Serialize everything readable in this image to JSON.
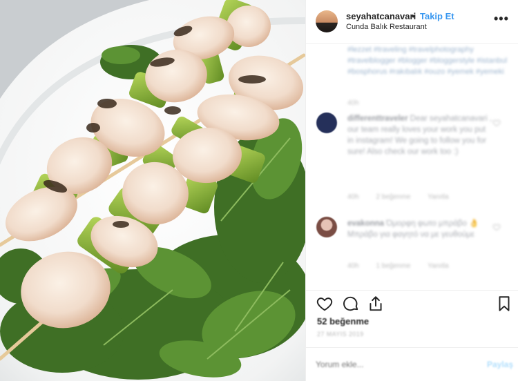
{
  "post": {
    "username": "seyahatcanavari",
    "separator": "•",
    "follow_label": "Takip Et",
    "location": "Cunda Balık Restaurant",
    "more_label": "•••"
  },
  "caption": {
    "hashtags": "#lezzet #traveling #travelphotography #travelblogger #blogger #bloggerstyle #istanbul #bosphorus #rakıbalık #ouzo #yemek #yemeki",
    "time": "40h"
  },
  "comments": [
    {
      "username": "differenttraveler",
      "text": "Dear seyahatcanavari , our team really loves your work you put in instagram! We going to follow you for sure! Also check our work too :)",
      "time": "40h",
      "likes": "2 beğenme",
      "reply": "Yanıtla"
    },
    {
      "username": "evakonna",
      "text": "Όμορφη φωτο μπράβο 👌 Μπράβο για φαγητό να με γευθούμε",
      "time": "40h",
      "likes": "1 beğenme",
      "reply": "Yanıtla"
    }
  ],
  "stats": {
    "likes": "52 beğenme",
    "date": "27 MAYIS 2019"
  },
  "add_comment": {
    "placeholder": "Yorum ekle...",
    "post_label": "Paylaş"
  },
  "icons": {
    "like": "heart-icon",
    "comment": "comment-bubble-icon",
    "share": "share-arrow-icon",
    "save": "bookmark-icon",
    "more": "more-dots-icon"
  },
  "colors": {
    "follow": "#3897f0",
    "text": "#262626",
    "border": "#efefef"
  }
}
